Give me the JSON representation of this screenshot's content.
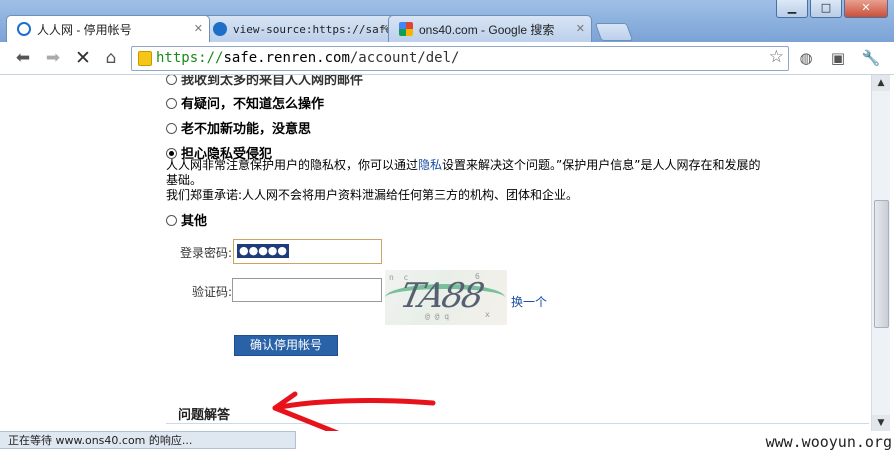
{
  "browser": {
    "tabs": [
      {
        "title": "人人网 - 停用帐号",
        "active": true,
        "favicon": "renren-icon"
      },
      {
        "title": "view-source:https://safe",
        "active": false,
        "favicon": "renren-icon"
      },
      {
        "title": "ons40.com - Google 搜索",
        "active": false,
        "favicon": "google-icon"
      }
    ],
    "window_controls": {
      "minimize": "▁",
      "maximize": "□",
      "close": "✕"
    },
    "url_scheme": "https://",
    "url_host": "safe.renren.com",
    "url_path": "/account/del/"
  },
  "page": {
    "cut_option": "我收到太多的来自人人网的邮件",
    "options": [
      {
        "label": "有疑问，不知道怎么操作",
        "checked": false
      },
      {
        "label": "老不加新功能，没意思",
        "checked": false
      },
      {
        "label": "担心隐私受侵犯",
        "checked": true
      }
    ],
    "privacy_desc": {
      "part1": "人人网非常注意保护用户的隐私权，你可以通过",
      "link": "隐私",
      "part2": "设置来解决这个问题。”保护用户信息”是人人网存在和发展的基础。",
      "line2": "我们郑重承诺:人人网不会将用户资料泄漏给任何第三方的机构、团体和企业。"
    },
    "other_option": "其他",
    "password_label": "登录密码:",
    "password_mask": "●●●●●",
    "captcha_label": "验证码:",
    "captcha_code": "TA88",
    "captcha_refresh": "换一个",
    "confirm_button": "确认停用帐号",
    "faq_title": "问题解答"
  },
  "status": {
    "text": "正在等待 www.ons40.com 的响应...",
    "watermark": "www.wooyun.org"
  },
  "colors": {
    "link": "#1a4da1",
    "confirm_bg": "#2a62a8",
    "annotation_arrow": "#e8121b"
  }
}
